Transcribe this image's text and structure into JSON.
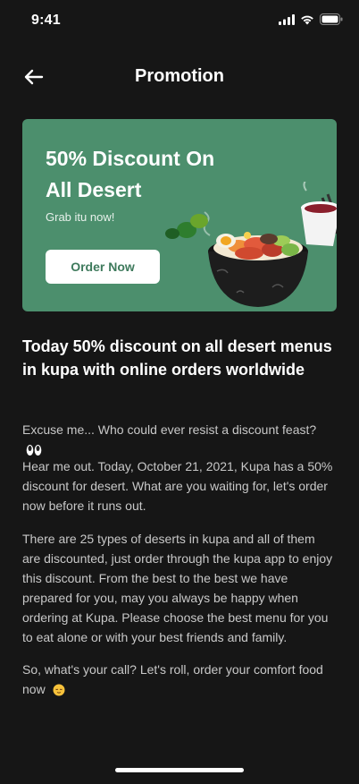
{
  "status_bar": {
    "time": "9:41",
    "icons": [
      "signal-icon",
      "wifi-icon",
      "battery-icon"
    ]
  },
  "header": {
    "title": "Promotion",
    "back_icon": "arrow-left-icon"
  },
  "banner": {
    "title": "50% Discount On All Desert",
    "subtitle": "Grab itu now!",
    "button_label": "Order Now",
    "background_color": "#4c8f6d",
    "button_text_color": "#3e7a5c"
  },
  "article": {
    "headline": "Today 50% discount on all desert menus in kupa with online orders worldwide",
    "paragraphs": [
      "Excuse me... Who could ever resist a discount feast?",
      "Hear me out. Today, October 21, 2021, Kupa has a 50% discount for desert. What are you waiting for, let's order now before it runs out.",
      "There are 25 types of deserts in kupa and all of them are discounted, just order through the kupa app to enjoy this discount. From the best to the best we have prepared for you, may you always be happy when ordering at Kupa. Please choose the best menu for you to eat alone or with your best friends and family.",
      "So, what's your call? Let's roll, order your comfort food now"
    ],
    "emoji_icons": [
      "eyes-emoji-icon",
      "relieved-face-emoji-icon"
    ]
  },
  "colors": {
    "background": "#161616",
    "text_primary": "#ffffff",
    "text_secondary": "#c8c8c8"
  }
}
